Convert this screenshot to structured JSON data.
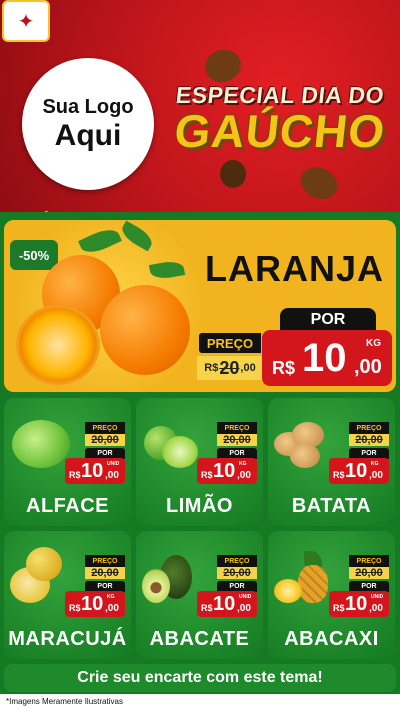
{
  "header": {
    "logo_line1": "Sua Logo",
    "logo_line2": "Aqui",
    "title_line1": "ESPECIAL DIA DO",
    "title_line2": "GAÚCHO"
  },
  "featured": {
    "discount": "-50%",
    "name": "LARANJA",
    "preco_label": "PREÇO",
    "old_currency": "R$",
    "old_int": "20",
    "old_dec": ",00",
    "por_label": "POR",
    "currency": "R$",
    "price_int": "10",
    "price_dec": ",00",
    "unit": "KG"
  },
  "products": [
    {
      "name": "ALFACE",
      "preco_label": "PREÇO",
      "old_price": "20,00",
      "por_label": "POR",
      "currency": "R$",
      "price_int": "10",
      "price_dec": ",00",
      "unit": "UNID"
    },
    {
      "name": "LIMÃO",
      "preco_label": "PREÇO",
      "old_price": "20,00",
      "por_label": "POR",
      "currency": "R$",
      "price_int": "10",
      "price_dec": ",00",
      "unit": "KG"
    },
    {
      "name": "BATATA",
      "preco_label": "PREÇO",
      "old_price": "20,00",
      "por_label": "POR",
      "currency": "R$",
      "price_int": "10",
      "price_dec": ",00",
      "unit": "KG"
    },
    {
      "name": "MARACUJÁ",
      "preco_label": "PREÇO",
      "old_price": "20,00",
      "por_label": "POR",
      "currency": "R$",
      "price_int": "10",
      "price_dec": ",00",
      "unit": "KG"
    },
    {
      "name": "ABACATE",
      "preco_label": "PREÇO",
      "old_price": "20,00",
      "por_label": "POR",
      "currency": "R$",
      "price_int": "10",
      "price_dec": ",00",
      "unit": "UNID"
    },
    {
      "name": "ABACAXI",
      "preco_label": "PREÇO",
      "old_price": "20,00",
      "por_label": "POR",
      "currency": "R$",
      "price_int": "10",
      "price_dec": ",00",
      "unit": "UNID"
    }
  ],
  "cta": "Crie seu encarte com este tema!",
  "disclaimer": "*Imagens Meramente Ilustrativas",
  "colors": {
    "brand_red": "#d2161b",
    "brand_green": "#1e8a2c",
    "brand_yellow": "#f6c318"
  }
}
